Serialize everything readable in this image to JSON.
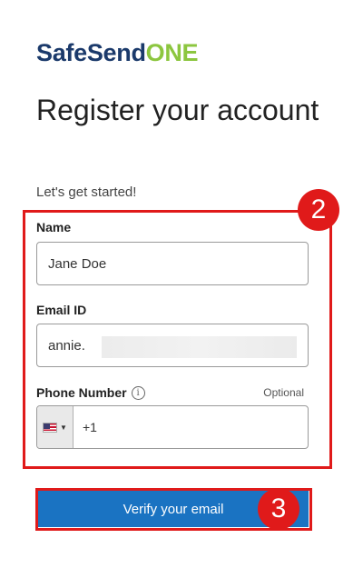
{
  "brand": {
    "part1": "SafeSend",
    "part2": "ONE",
    "color_primary": "#1b3a6b",
    "color_accent": "#8cc63f"
  },
  "heading": "Register your account",
  "subtitle": "Let's get started!",
  "form": {
    "name": {
      "label": "Name",
      "value": "Jane Doe"
    },
    "email": {
      "label": "Email ID",
      "value": "annie."
    },
    "phone": {
      "label": "Phone Number",
      "optional_label": "Optional",
      "info_icon": "info-icon",
      "country_flag": "us-flag-icon",
      "dial_code": "+1"
    }
  },
  "verify_button": {
    "label": "Verify your email",
    "color": "#1a73c2"
  },
  "annotations": {
    "step_2": "2",
    "step_3": "3",
    "highlight_color": "#e01a1a"
  }
}
